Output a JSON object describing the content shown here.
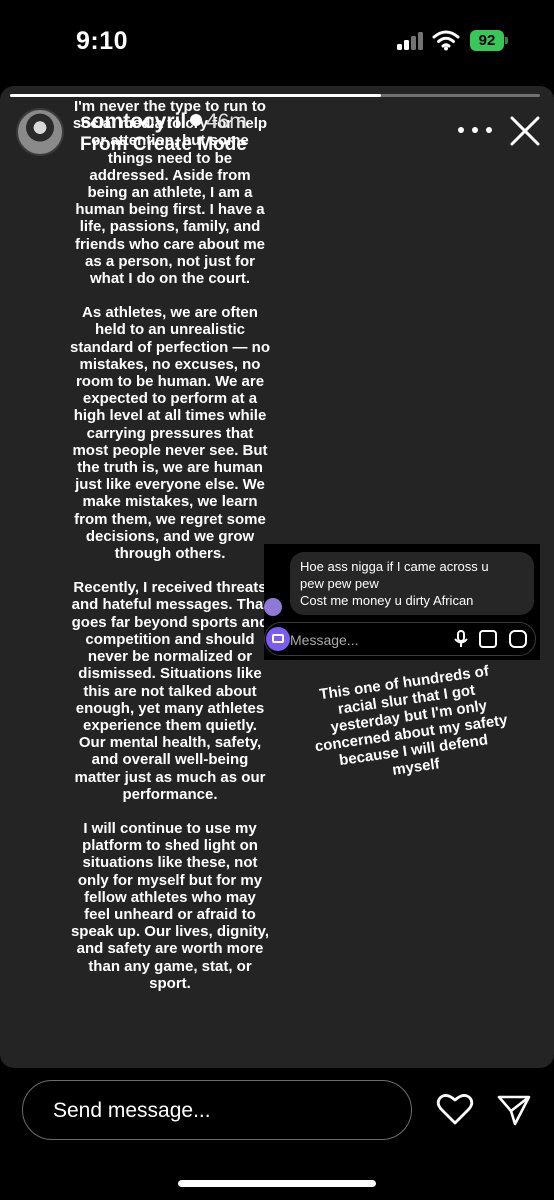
{
  "status_bar": {
    "time": "9:10",
    "battery": "92"
  },
  "story": {
    "progress_fraction": 0.7,
    "username": "somtocyril",
    "time_ago": "46m",
    "subtitle": "From Create Mode",
    "statement_paragraphs": [
      "I'm never the type to run to social media to cry for help or attention, but some things need to be addressed. Aside from being an athlete, I am a human being first. I have a life, passions, family, and friends who care about me as a person, not just for what I do on the court.",
      "As athletes, we are often held to an unrealistic standard of perfection — no mistakes, no excuses, no room to be human. We are expected to perform at a high level at all times while carrying pressures that most people never see. But the truth is, we are human just like everyone else. We make mistakes, we learn from them, we regret some decisions, and we grow through others.",
      "Recently, I received threats and hateful messages. That goes far beyond sports and competition and should never be normalized or dismissed. Situations like this are not talked about enough, yet many athletes experience them quietly. Our mental health, safety, and overall well-being matter just as much as our performance.",
      "I will continue to use my platform to shed light on situations like these, not only for myself but for my fellow athletes who may feel unheard or afraid to speak up. Our lives, dignity, and safety are worth more than any game, stat, or sport."
    ],
    "dm": {
      "message_lines": [
        "Hoe ass nigga if I came across u",
        "pew pew pew",
        "Cost me money u dirty African"
      ],
      "input_placeholder": "Message..."
    },
    "caption": "This one of hundreds of racial slur that I got yesterday but I'm only concerned about my safety because I will defend myself"
  },
  "bottom_bar": {
    "send_placeholder": "Send message..."
  },
  "colors": {
    "story_background": "#242424",
    "battery_green": "#38c759",
    "camera_purple": "#7a5cf0"
  },
  "icons": [
    "signal-icon",
    "wifi-icon",
    "more-icon",
    "close-icon",
    "camera-icon",
    "mic-icon",
    "gallery-icon",
    "sticker-icon",
    "heart-icon",
    "send-icon"
  ]
}
